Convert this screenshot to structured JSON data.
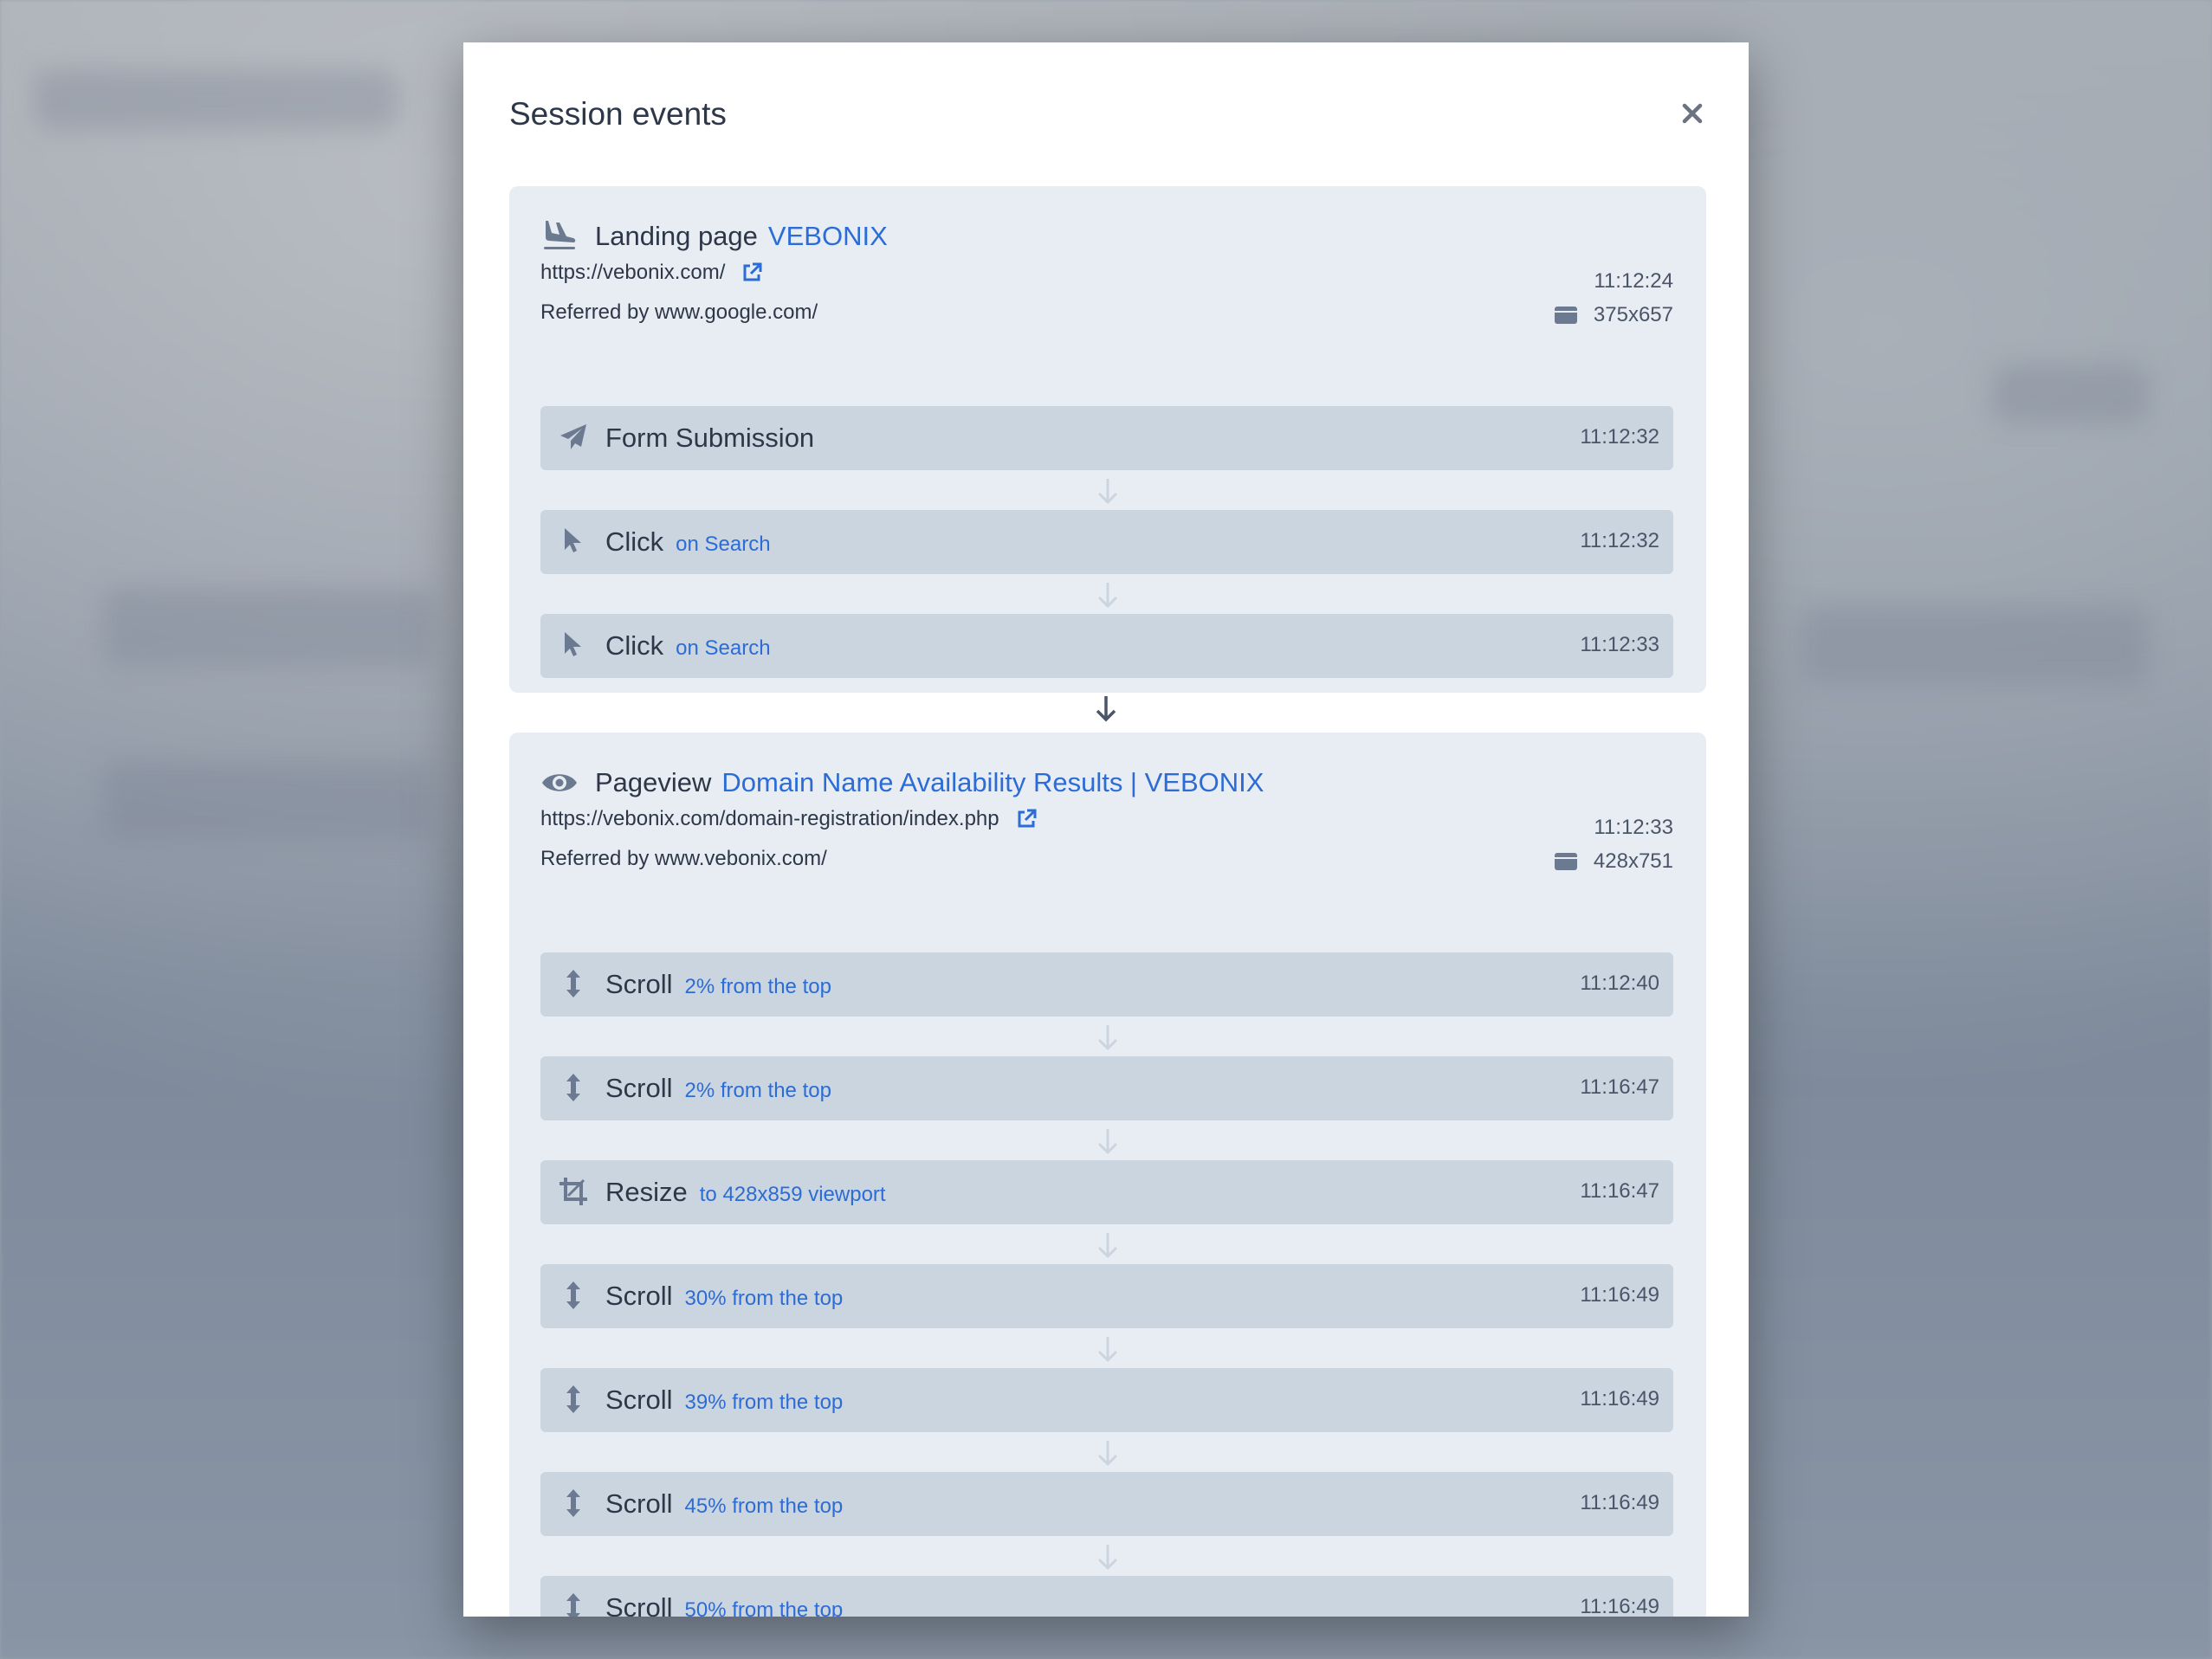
{
  "modal": {
    "title": "Session events",
    "close_label": "×"
  },
  "groups": [
    {
      "type_label": "Landing page",
      "type_icon": "plane-landing-icon",
      "title": "VEBONIX",
      "url": "https://vebonix.com/",
      "referrer": "Referred by www.google.com/",
      "time": "11:12:24",
      "viewport": "375x657",
      "events": [
        {
          "icon": "paper-plane-icon",
          "name": "Form Submission",
          "detail": "",
          "time": "11:12:32"
        },
        {
          "icon": "cursor-icon",
          "name": "Click",
          "detail": "on Search",
          "time": "11:12:32"
        },
        {
          "icon": "cursor-icon",
          "name": "Click",
          "detail": "on Search",
          "time": "11:12:33"
        }
      ]
    },
    {
      "type_label": "Pageview",
      "type_icon": "eye-icon",
      "title": "Domain Name Availability Results | VEBONIX",
      "url": "https://vebonix.com/domain-registration/index.php",
      "referrer": "Referred by www.vebonix.com/",
      "time": "11:12:33",
      "viewport": "428x751",
      "events": [
        {
          "icon": "scroll-vertical-icon",
          "name": "Scroll",
          "detail": "2% from the top",
          "time": "11:12:40"
        },
        {
          "icon": "scroll-vertical-icon",
          "name": "Scroll",
          "detail": "2% from the top",
          "time": "11:16:47"
        },
        {
          "icon": "crop-icon",
          "name": "Resize",
          "detail": "to 428x859 viewport",
          "time": "11:16:47"
        },
        {
          "icon": "scroll-vertical-icon",
          "name": "Scroll",
          "detail": "30% from the top",
          "time": "11:16:49"
        },
        {
          "icon": "scroll-vertical-icon",
          "name": "Scroll",
          "detail": "39% from the top",
          "time": "11:16:49"
        },
        {
          "icon": "scroll-vertical-icon",
          "name": "Scroll",
          "detail": "45% from the top",
          "time": "11:16:49"
        },
        {
          "icon": "scroll-vertical-icon",
          "name": "Scroll",
          "detail": "50% from the top",
          "time": "11:16:49"
        }
      ]
    }
  ],
  "colors": {
    "accent": "#2b6cd6",
    "group_bg": "#e8edf4",
    "event_bg": "#cbd5e0",
    "icon": "#6b7a90"
  }
}
